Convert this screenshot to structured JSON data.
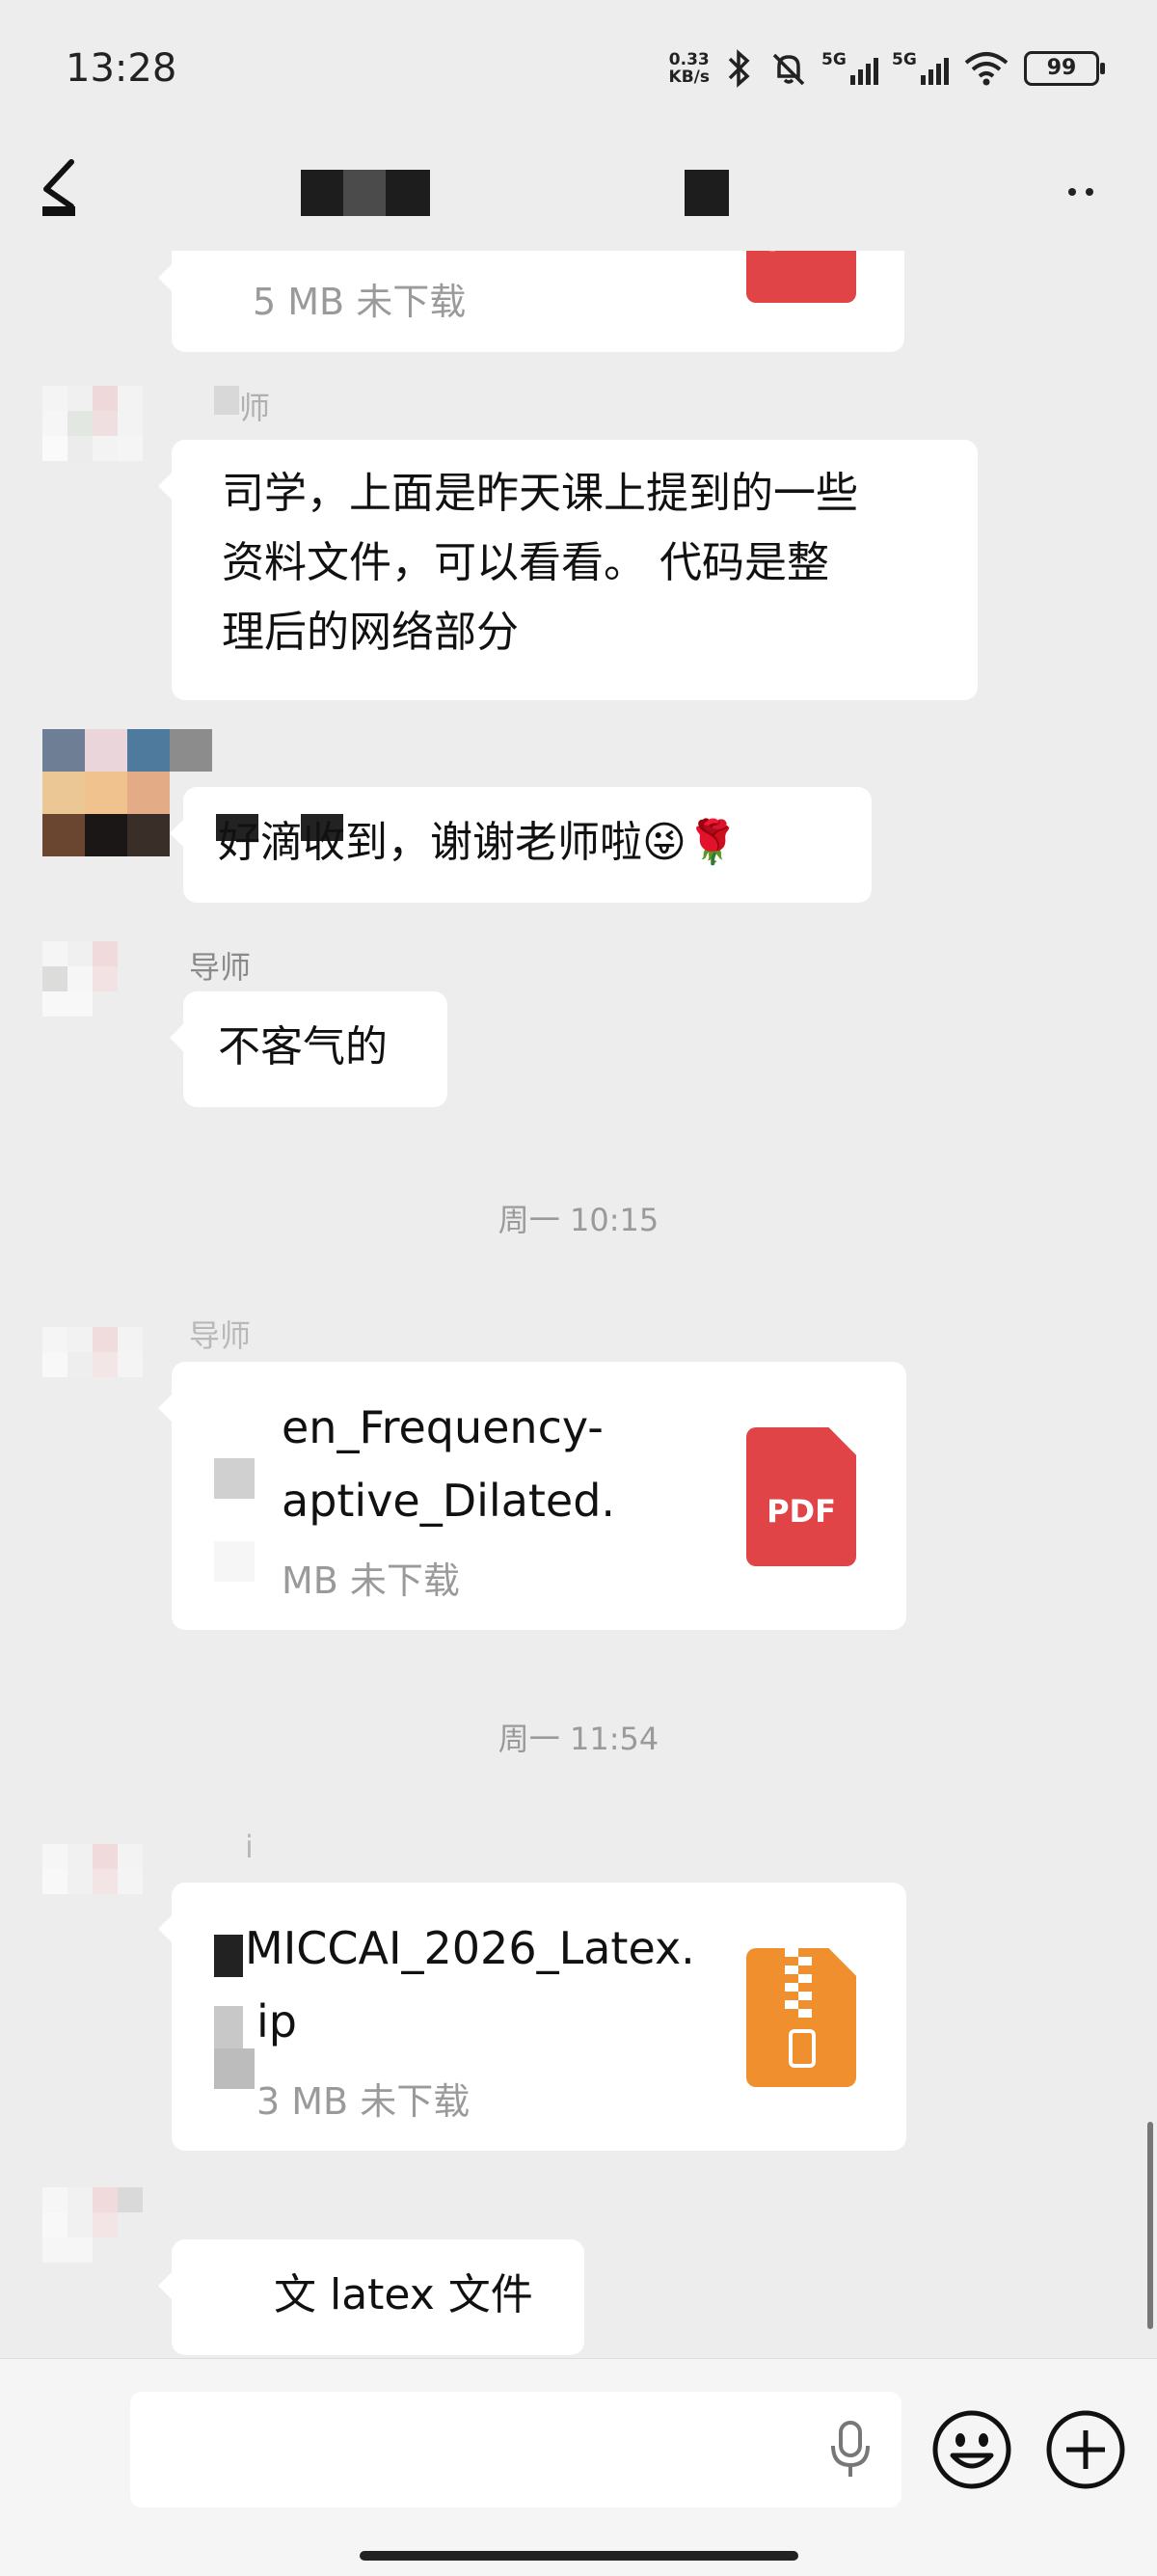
{
  "status_bar": {
    "time": "13:28",
    "net_speed_value": "0.33",
    "net_speed_unit": "KB/s",
    "signal1_label": "5G",
    "signal2_label": "5G",
    "battery": "99"
  },
  "header": {
    "back_icon": "back-arrow-icon",
    "more_icon": "more-dots-icon"
  },
  "messages": {
    "m0": {
      "file_info": "5 MB  未下载",
      "file_type": "PDF"
    },
    "m1": {
      "sender": "师",
      "text_line1": "司学，上面是昨天课上提到的一些",
      "text_line2": "资料文件，可以看看。 代码是整",
      "text_line3": "理后的网络部分"
    },
    "m2": {
      "text": "好滴收到，谢谢老师啦",
      "emoji1": "😜",
      "emoji2": "🌹"
    },
    "m3": {
      "sender": "导师",
      "text": "不客气的"
    },
    "sep1": "周一 10:15",
    "m4": {
      "sender": "导师",
      "file_line1": "en_Frequency-",
      "file_line2": "aptive_Dilated.",
      "file_info": "MB  未下载",
      "file_type": "PDF"
    },
    "sep2": "周一 11:54",
    "m5": {
      "sender": "i",
      "file_line1": "MICCAI_2026_Latex.",
      "file_line2": "ip",
      "file_info": "3 MB  未下载"
    },
    "m6": {
      "text": "文 latex 文件"
    }
  },
  "input_bar": {
    "mic_icon": "microphone-icon",
    "emoji_icon": "emoji-icon",
    "plus_icon": "plus-icon"
  },
  "colors": {
    "background": "#ededed",
    "pdf_red": "#e04446",
    "zip_orange": "#ef8f2e"
  }
}
